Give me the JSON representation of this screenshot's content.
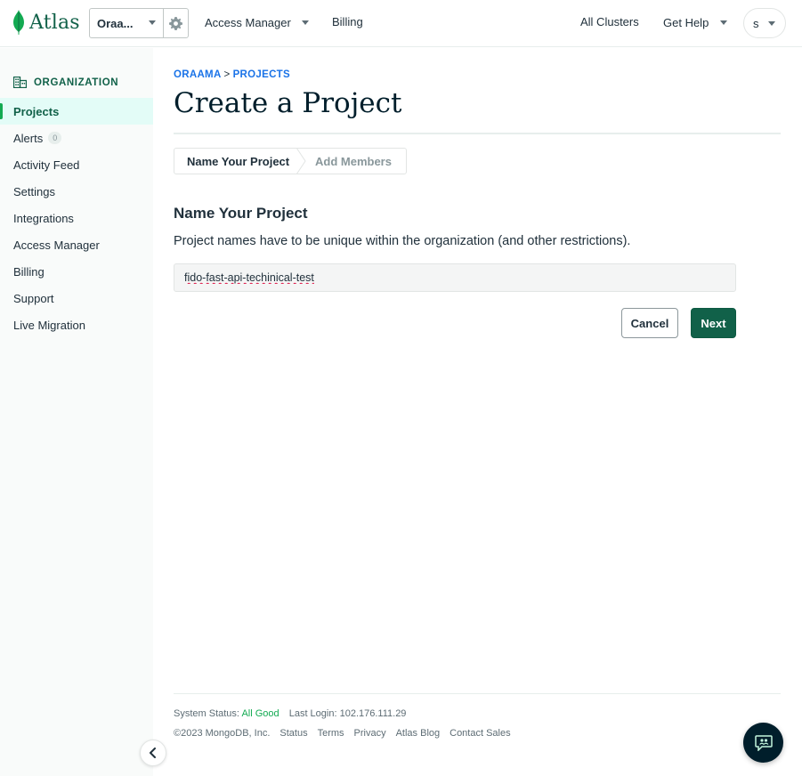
{
  "topbar": {
    "logo_text": "Atlas",
    "org_name": "Oraa...",
    "access_manager": "Access Manager",
    "billing": "Billing",
    "all_clusters": "All Clusters",
    "get_help": "Get Help",
    "user_initial": "s"
  },
  "sidebar": {
    "header": "ORGANIZATION",
    "items": [
      {
        "label": "Projects",
        "active": true
      },
      {
        "label": "Alerts",
        "badge": "0"
      },
      {
        "label": "Activity Feed"
      },
      {
        "label": "Settings"
      },
      {
        "label": "Integrations"
      },
      {
        "label": "Access Manager"
      },
      {
        "label": "Billing"
      },
      {
        "label": "Support"
      },
      {
        "label": "Live Migration"
      }
    ]
  },
  "main": {
    "breadcrumb": {
      "org": "ORAAMA",
      "separator": ">",
      "section": "PROJECTS"
    },
    "title": "Create a Project",
    "steps": [
      "Name Your Project",
      "Add Members"
    ],
    "section_title": "Name Your Project",
    "section_desc": "Project names have to be unique within the organization (and other restrictions).",
    "project_name_value": "fido-fast-api-techinical-test",
    "cancel_label": "Cancel",
    "next_label": "Next"
  },
  "footer": {
    "status_label": "System Status:",
    "status_value": "All Good",
    "last_login_label": "Last Login:",
    "last_login_ip": "102.176.111.29",
    "copyright": "©2023 MongoDB, Inc.",
    "links": [
      "Status",
      "Terms",
      "Privacy",
      "Atlas Blog",
      "Contact Sales"
    ]
  },
  "colors": {
    "brand_green": "#116149",
    "accent_green": "#13aa52",
    "link_blue": "#016bf8",
    "active_bg": "#e3fcf7"
  }
}
